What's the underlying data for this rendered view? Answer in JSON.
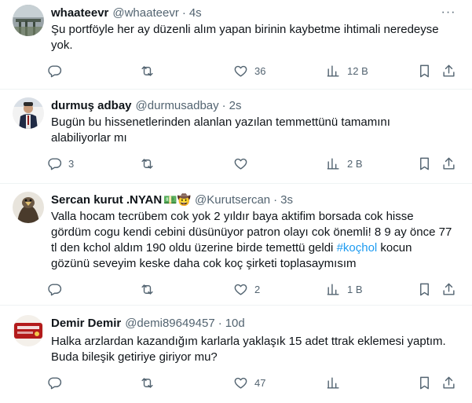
{
  "tweets": [
    {
      "display_name": "whaateevr",
      "handle": "@whaateevr",
      "time": "4s",
      "text": "Şu portföyle her ay düzenli alım yapan birinin kaybetme ihtimali neredeyse yok.",
      "replies": "",
      "likes": "36",
      "views": "12 B"
    },
    {
      "display_name": "durmuş adbay",
      "handle": "@durmusadbay",
      "time": "2s",
      "text": "Bugün bu hissenetlerinden alanlan yazılan temmettünü tamamını alabiliyorlar mı",
      "replies": "3",
      "likes": "",
      "views": "2 B"
    },
    {
      "display_name": "Sercan kurut .NYAN",
      "name_emojis": "💵🤠",
      "handle": "@Kurutsercan",
      "time": "3s",
      "text_before": "Valla hocam tecrübem cok yok 2 yıldır baya  aktifim borsada cok hisse gördüm cogu kendi cebini düsünüyor patron olayı cok önemli! 8 9 ay önce 77 tl den kchol aldım 190 oldu üzerine birde temettü geldi ",
      "hashtag": "#koçhol",
      "text_after": " kocun gözünü seveyim keske daha cok koç şirketi toplasaymısım",
      "replies": "",
      "likes": "2",
      "views": "1 B"
    },
    {
      "display_name": "Demir Demir",
      "handle": "@demi89649457",
      "time": "10d",
      "text": "Halka arzlardan kazandığım karlarla yaklaşık 15 adet ttrak eklemesi yaptım. Buda bileşik getiriye giriyor mu?",
      "replies": "",
      "likes": "47",
      "views": ""
    }
  ],
  "dot": "·",
  "more_glyph": "···",
  "colors": {
    "text": "#0f1419",
    "secondary": "#536471",
    "accent": "#1d9bf0",
    "divider": "#eff3f4"
  },
  "icons": [
    "reply-icon",
    "retweet-icon",
    "like-icon",
    "views-icon",
    "bookmark-icon",
    "share-icon",
    "more-icon"
  ]
}
